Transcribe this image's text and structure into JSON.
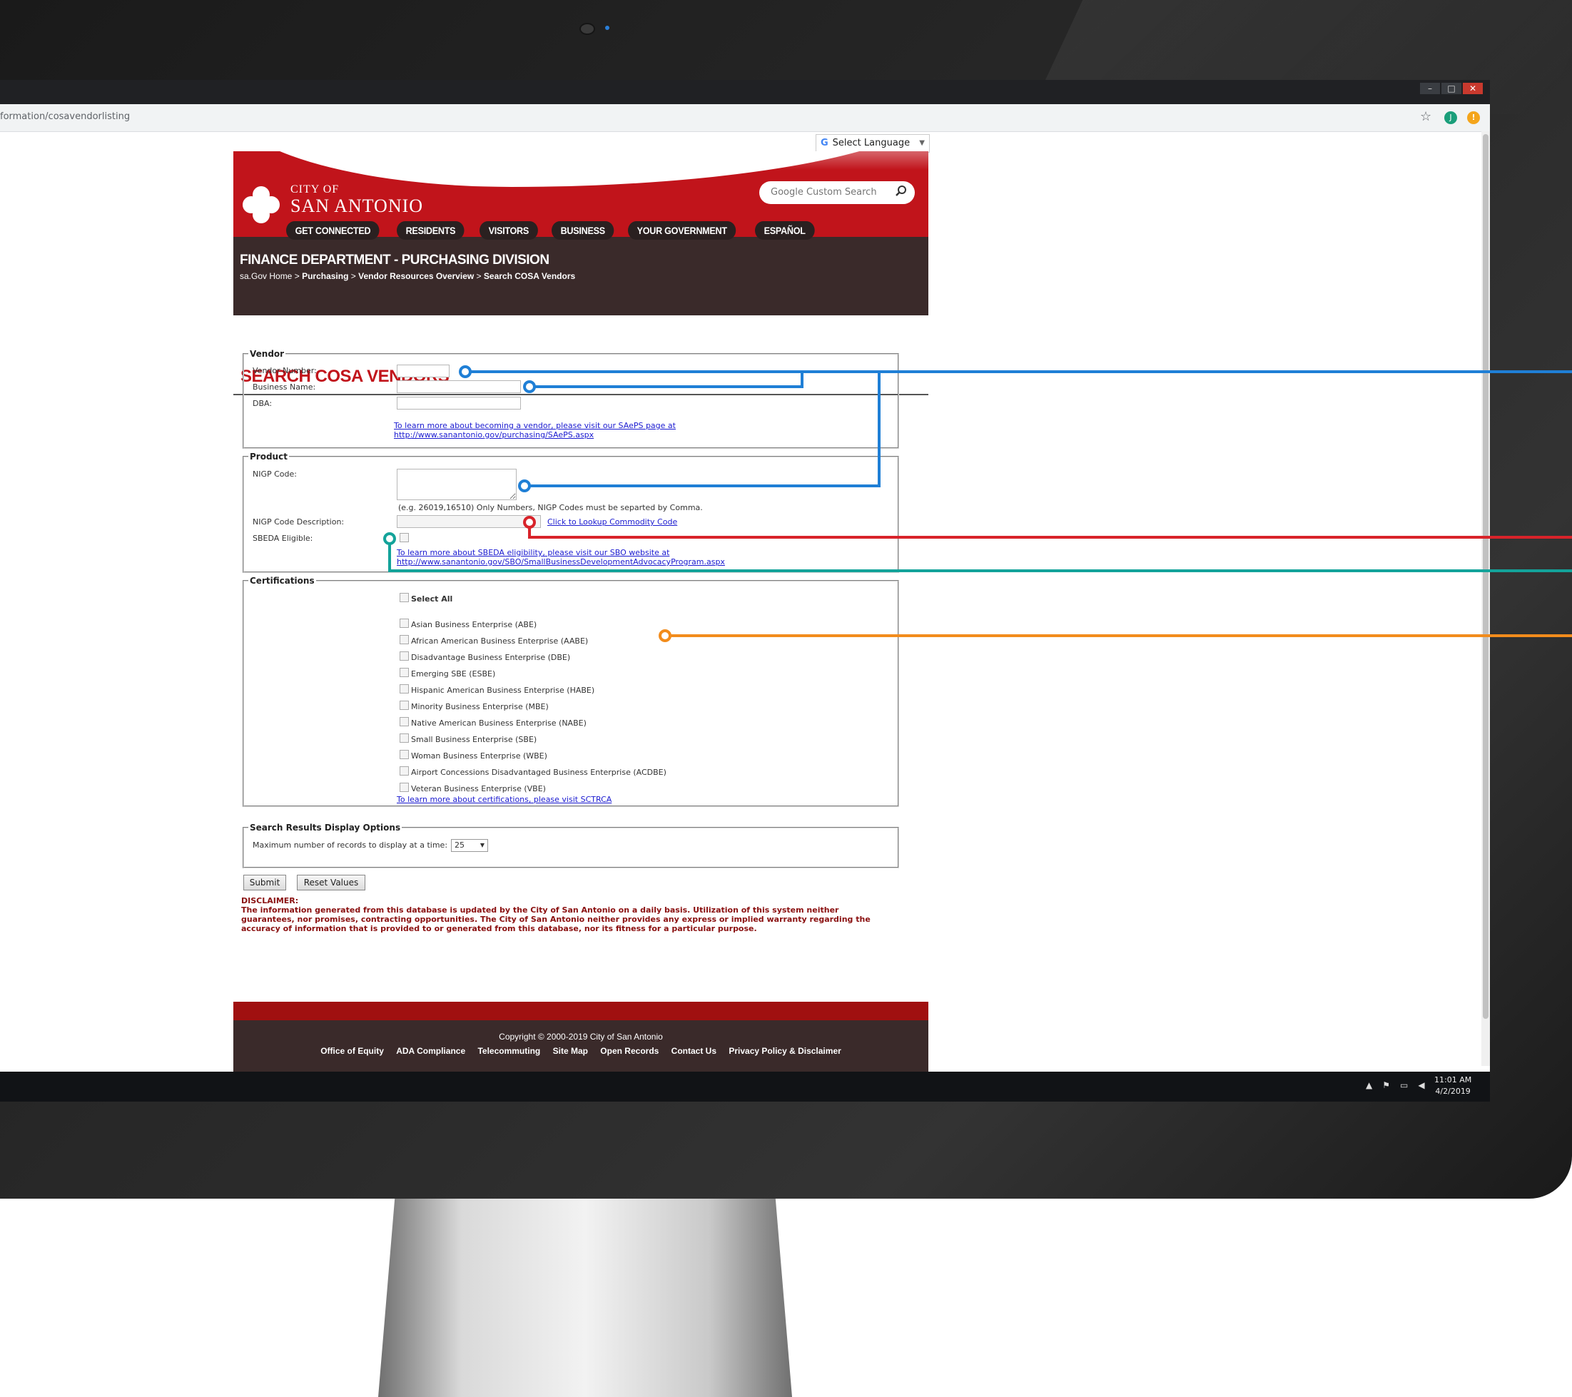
{
  "browser": {
    "url": "formation/cosavendorlisting",
    "profile_initial": "J",
    "extension_badge": "!",
    "window_buttons": [
      "–",
      "□",
      "✕"
    ]
  },
  "site": {
    "language_selector": "Select Language",
    "google_glyph": "G",
    "language_arrow": "▼",
    "city_of": "CITY OF",
    "city_name": "SAN ANTONIO",
    "search_placeholder": "Google Custom Search",
    "nav": [
      "GET CONNECTED",
      "RESIDENTS",
      "VISITORS",
      "BUSINESS",
      "YOUR GOVERNMENT",
      "ESPAÑOL"
    ],
    "department": "FINANCE DEPARTMENT - PURCHASING DIVISION",
    "breadcrumb": {
      "home": "sa.Gov Home",
      "items": [
        "Purchasing",
        "Vendor Resources Overview",
        "Search COSA Vendors"
      ],
      "separator": ">"
    },
    "page_title": "SEARCH COSA VENDORS"
  },
  "form": {
    "vendor": {
      "legend": "Vendor",
      "vendor_number_label": "Vendor Number:",
      "business_name_label": "Business Name:",
      "dba_label": "DBA:",
      "link_line1": "To learn more about becoming a vendor, please visit our SAePS page at",
      "link_line2": "http://www.sanantonio.gov/purchasing/SAePS.aspx"
    },
    "product": {
      "legend": "Product",
      "nigp_code_label": "NIGP Code:",
      "nigp_hint": "(e.g. 26019,16510) Only Numbers, NIGP Codes must be separted by Comma.",
      "nigp_desc_label": "NIGP Code Description:",
      "lookup_link": "Click to Lookup Commodity Code",
      "sbeda_label": "SBEDA Eligible:",
      "sbeda_link_line1": "To learn more about SBEDA eligibility, please visit our SBO website at",
      "sbeda_link_line2": "http://www.sanantonio.gov/SBO/SmallBusinessDevelopmentAdvocacyProgram.aspx"
    },
    "certifications": {
      "legend": "Certifications",
      "select_all": "Select All",
      "items": [
        "Asian Business Enterprise (ABE)",
        "African American Business Enterprise (AABE)",
        "Disadvantage Business Enterprise (DBE)",
        "Emerging SBE (ESBE)",
        "Hispanic American Business Enterprise (HABE)",
        "Minority Business Enterprise (MBE)",
        "Native American Business Enterprise (NABE)",
        "Small Business Enterprise (SBE)",
        "Woman Business Enterprise (WBE)",
        "Airport Concessions Disadvantaged Business Enterprise (ACDBE)",
        "Veteran Business Enterprise (VBE)"
      ],
      "link": "To learn more about certifications, please visit SCTRCA"
    },
    "display_options": {
      "legend": "Search Results Display Options",
      "max_label": "Maximum number of records to display at a time:",
      "max_value": "25"
    },
    "submit_label": "Submit",
    "reset_label": "Reset Values",
    "disclaimer_title": "DISCLAIMER:",
    "disclaimer_text": "The information generated from this database is updated by the City of San Antonio on a daily basis. Utilization of this system neither guarantees, nor promises, contracting opportunities. The City of San Antonio neither provides any express or implied warranty regarding the accuracy of information that is provided to or generated from this database, nor its fitness for a particular purpose."
  },
  "footer": {
    "copyright": "Copyright © 2000-2019 City of San Antonio",
    "links": [
      "Office of Equity",
      "ADA Compliance",
      "Telecommuting",
      "Site Map",
      "Open Records",
      "Contact Us",
      "Privacy Policy & Disclaimer"
    ]
  },
  "taskbar": {
    "time": "11:01 AM",
    "date": "4/2/2019"
  },
  "annotation_colors": {
    "blue": "#1f7fd6",
    "red": "#d8232a",
    "teal": "#13a39a",
    "orange": "#f28c1c"
  }
}
